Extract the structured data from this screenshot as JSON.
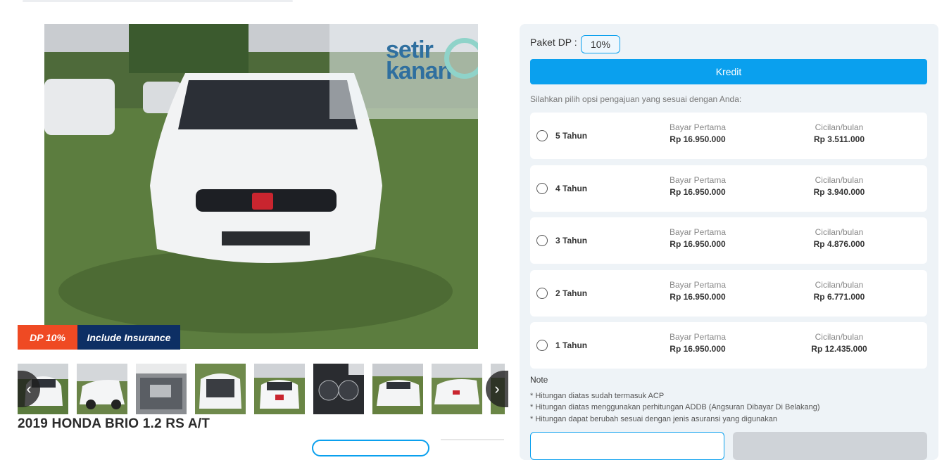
{
  "badges": {
    "dp": "DP 10%",
    "insurance": "Include Insurance"
  },
  "watermark": {
    "line1": "setir",
    "line2": "kanan"
  },
  "car": {
    "title": "2019 HONDA BRIO 1.2 RS A/T"
  },
  "gallery": {
    "prev_icon": "chevron-left-icon",
    "next_icon": "chevron-right-icon",
    "thumbnail_count_visible": 9
  },
  "kredit": {
    "paket_label": "Paket DP :",
    "paket_value": "10%",
    "tab_label": "Kredit",
    "hint": "Silahkan pilih opsi pengajuan yang sesuai dengan Anda:",
    "options": [
      {
        "tenor": "5 Tahun",
        "bp_label": "Bayar Pertama",
        "bp_value": "Rp 16.950.000",
        "cb_label": "Cicilan/bulan",
        "cb_value": "Rp 3.511.000"
      },
      {
        "tenor": "4 Tahun",
        "bp_label": "Bayar Pertama",
        "bp_value": "Rp 16.950.000",
        "cb_label": "Cicilan/bulan",
        "cb_value": "Rp 3.940.000"
      },
      {
        "tenor": "3 Tahun",
        "bp_label": "Bayar Pertama",
        "bp_value": "Rp 16.950.000",
        "cb_label": "Cicilan/bulan",
        "cb_value": "Rp 4.876.000"
      },
      {
        "tenor": "2 Tahun",
        "bp_label": "Bayar Pertama",
        "bp_value": "Rp 16.950.000",
        "cb_label": "Cicilan/bulan",
        "cb_value": "Rp 6.771.000"
      },
      {
        "tenor": "1 Tahun",
        "bp_label": "Bayar Pertama",
        "bp_value": "Rp 16.950.000",
        "cb_label": "Cicilan/bulan",
        "cb_value": "Rp 12.435.000"
      }
    ],
    "note_title": "Note",
    "notes": [
      "* Hitungan diatas sudah termasuk ACP",
      "* Hitungan diatas menggunakan perhitungan ADDB (Angsuran Dibayar Di Belakang)",
      "* Hitungan dapat berubah sesuai dengan jenis asuransi yang digunakan"
    ]
  },
  "colors": {
    "accent": "#0aa0ee",
    "dp_badge": "#ef4a23",
    "insurance_badge": "#0d2f64",
    "panel_bg": "#eef3f7"
  }
}
